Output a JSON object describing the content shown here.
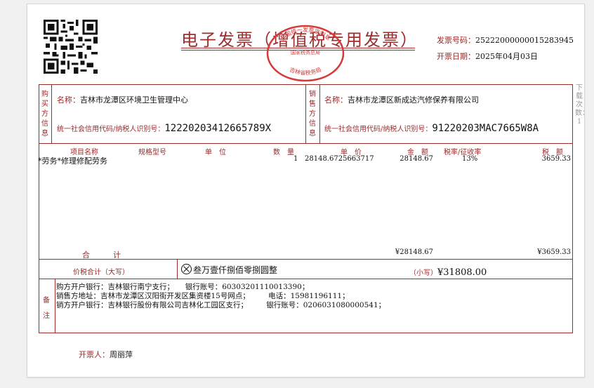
{
  "invoice": {
    "title": "电子发票（增值税专用发票）",
    "number_label": "发票号码：",
    "number": "25222000000015283945",
    "date_label": "开票日期：",
    "date": "2025年04月03日",
    "side_note": "下载次数：1"
  },
  "seal": {
    "top_text": "国家税务总局",
    "bottom_text": "吉林省税务局",
    "middle_text": "全国统一发票监制章"
  },
  "buyer": {
    "section_label": "购买方信息",
    "name_label": "名称：",
    "name": "吉林市龙潭区环境卫生管理中心",
    "tax_label": "统一社会信用代码/纳税人识别号：",
    "tax_id": "12220203412665789X"
  },
  "seller": {
    "section_label": "销售方信息",
    "name_label": "名称：",
    "name": "吉林市龙潭区新成达汽修保养有限公司",
    "tax_label": "统一社会信用代码/纳税人识别号：",
    "tax_id": "91220203MAC7665W8A"
  },
  "columns": {
    "item": "项目名称",
    "spec": "规格型号",
    "unit": "单　位",
    "qty": "数　量",
    "price": "单　价",
    "amount": "金　额",
    "rate": "税率/征收率",
    "tax": "税　额"
  },
  "items": [
    {
      "item": "*劳务*修理修配劳务",
      "qty": "1",
      "price": "28148.6725663717",
      "amount": "28148.67",
      "rate": "13%",
      "tax": "3659.33"
    }
  ],
  "totals": {
    "label": "合　　　计",
    "amount": "¥28148.67",
    "tax": "¥3659.33"
  },
  "grand_total": {
    "label": "价税合计（大写）",
    "capital": "叁万壹仟捌佰零捌圆整",
    "small_label": "（小写）",
    "small": "¥31808.00"
  },
  "remarks": {
    "label": "备注",
    "line1": "购方开户银行：吉林银行南宁支行；　　银行账号：60303201110013390；",
    "line2": "销售方地址：吉林市龙潭区汉阳街开发区集资楼15号网点；　　　电话：15981196111；",
    "line3": "销方开户银行：吉林银行股份有限公司吉林化工园区支行；　　　银行账号：0206031080000541；"
  },
  "issuer": {
    "label": "开票人：",
    "name": "周丽萍"
  },
  "colors": {
    "accent": "#a12c2c",
    "text": "#111111"
  }
}
